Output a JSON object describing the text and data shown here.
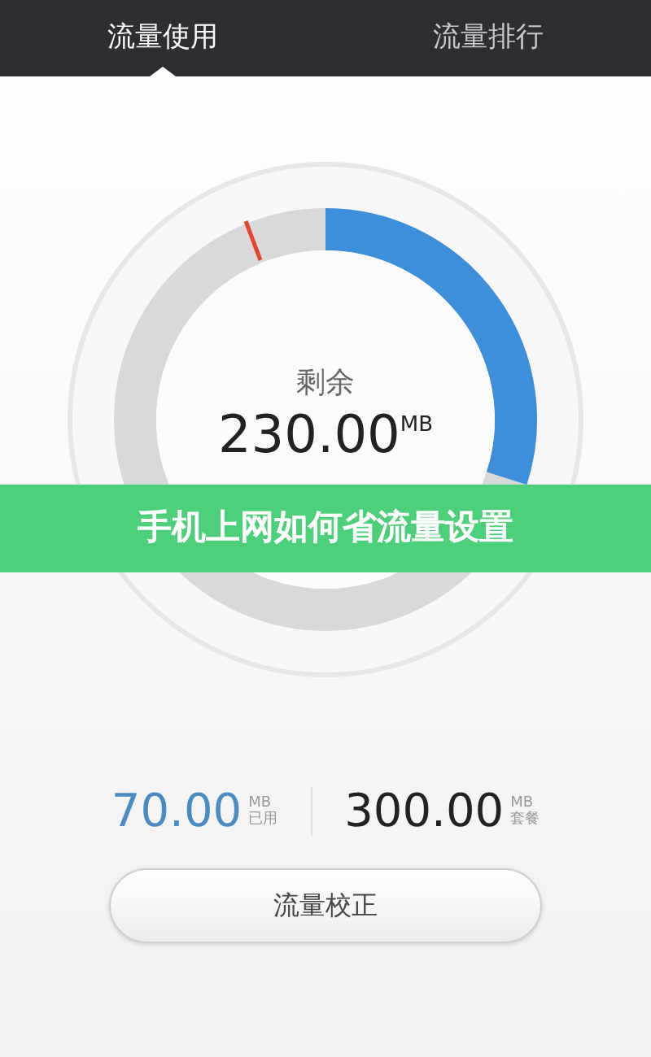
{
  "tabs": [
    {
      "label": "流量使用",
      "selected": true
    },
    {
      "label": "流量排行",
      "selected": false
    }
  ],
  "gauge": {
    "caption": "剩余",
    "value": "230.00",
    "unit": "MB"
  },
  "banner": "手机上网如何省流量设置",
  "stats": [
    {
      "kind": "used",
      "value": "70.00",
      "unit": "MB",
      "label": "已用"
    },
    {
      "kind": "plan",
      "value": "300.00",
      "unit": "MB",
      "label": "套餐"
    }
  ],
  "button": "流量校正"
}
